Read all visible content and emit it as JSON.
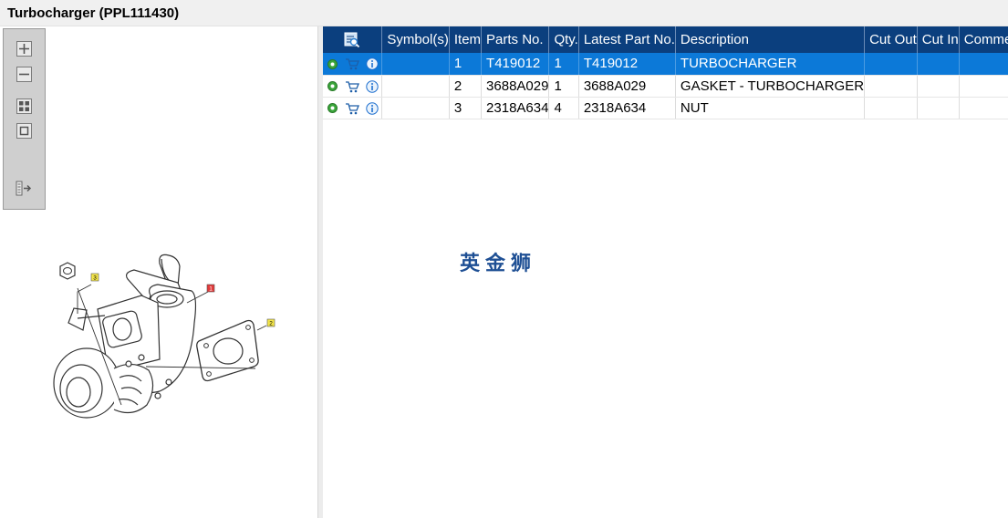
{
  "window": {
    "title": "Turbocharger (PPL111430)"
  },
  "toolbar": {
    "items": [
      {
        "name": "zoom-in",
        "icon": "zoom-in-icon"
      },
      {
        "name": "zoom-out",
        "icon": "zoom-out-icon"
      },
      {
        "name": "fit",
        "icon": "fit-page-icon"
      },
      {
        "name": "actual-size",
        "icon": "actual-size-icon"
      },
      {
        "name": "export",
        "icon": "export-icon"
      }
    ]
  },
  "diagram": {
    "callouts": [
      {
        "label": "3",
        "color": "#f5e74a"
      },
      {
        "label": "1",
        "color": "#e23a3a"
      },
      {
        "label": "2",
        "color": "#f5e74a"
      }
    ]
  },
  "grid": {
    "header_icon": "search-list-icon",
    "columns": [
      "Symbol(s)",
      "Item",
      "Parts No.",
      "Qty.",
      "Latest Part No.",
      "Description",
      "Cut Out",
      "Cut In",
      "Comment"
    ],
    "rows": [
      {
        "symbols": "",
        "item": "1",
        "part_no": "T419012",
        "qty": "1",
        "latest_part_no": "T419012",
        "description": "TURBOCHARGER",
        "cut_out": "",
        "cut_in": "",
        "comment": "",
        "selected": true
      },
      {
        "symbols": "",
        "item": "2",
        "part_no": "3688A029",
        "qty": "1",
        "latest_part_no": "3688A029",
        "description": "GASKET - TURBOCHARGER",
        "cut_out": "",
        "cut_in": "",
        "comment": "",
        "selected": false
      },
      {
        "symbols": "",
        "item": "3",
        "part_no": "2318A634",
        "qty": "4",
        "latest_part_no": "2318A634",
        "description": "NUT",
        "cut_out": "",
        "cut_in": "",
        "comment": "",
        "selected": false
      }
    ],
    "row_icons": [
      "gear-icon",
      "cart-icon",
      "info-icon"
    ],
    "watermark": "英金狮"
  },
  "colors": {
    "header_bg": "#0b3f7e",
    "selected_row": "#0c79d8",
    "gear": "#3aa53a",
    "info": "#1e6fcf"
  }
}
